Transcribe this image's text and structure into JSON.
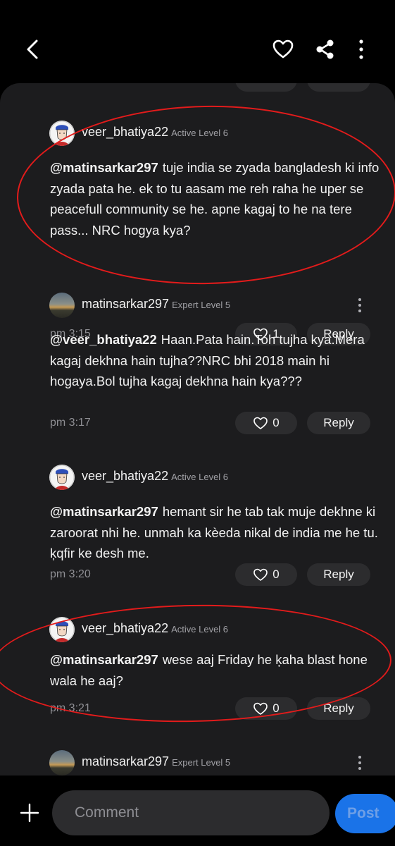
{
  "topbar": {
    "back_icon": "chevron-left-icon",
    "favorite_icon": "heart-icon",
    "share_icon": "share-icon",
    "more_icon": "more-vertical-icon"
  },
  "comments": [
    {
      "username": "veer_bhatiya22",
      "level": "Active Level 6",
      "mention": "@matinsarkar297",
      "text": "tuje india se zyada bangladesh ki info zyada pata he. ek to tu aasam me reh raha he uper se peacefull community se he. apne kagaj to he na tere pass... NRC hogya kya?",
      "time": "pm 3:15",
      "likes": "1",
      "reply_label": "Reply"
    },
    {
      "username": "matinsarkar297",
      "level": "Expert Level 5",
      "mention": "@veer_bhatiya22",
      "text": "Haan.Pata hain.Toh tujha kya.Mera kagaj dekhna hain tujha??NRC bhi 2018 main hi hogaya.Bol tujha kagaj dekhna hain kya???",
      "time": "pm 3:17",
      "likes": "0",
      "reply_label": "Reply"
    },
    {
      "username": "veer_bhatiya22",
      "level": "Active Level 6",
      "mention": "@matinsarkar297",
      "text": "hemant sir he tab tak muje dekhne ki zaroorat nhi he. unmah ka kèeda nikal de india me he tu. ķqfir ke desh me.",
      "time": "pm 3:20",
      "likes": "0",
      "reply_label": "Reply"
    },
    {
      "username": "veer_bhatiya22",
      "level": "Active Level 6",
      "mention": "@matinsarkar297",
      "text": "wese aaj Friday he ķaha blast hone wala he aaj?",
      "time": "pm 3:21",
      "likes": "0",
      "reply_label": "Reply"
    },
    {
      "username": "matinsarkar297",
      "level": "Expert Level 5"
    }
  ],
  "composer": {
    "placeholder": "Comment",
    "post_label": "Post"
  },
  "colors": {
    "background": "#000000",
    "panel": "#1c1c1e",
    "pill": "#2c2c2e",
    "accent": "#1a73e8",
    "annotation": "#e31b1b"
  }
}
